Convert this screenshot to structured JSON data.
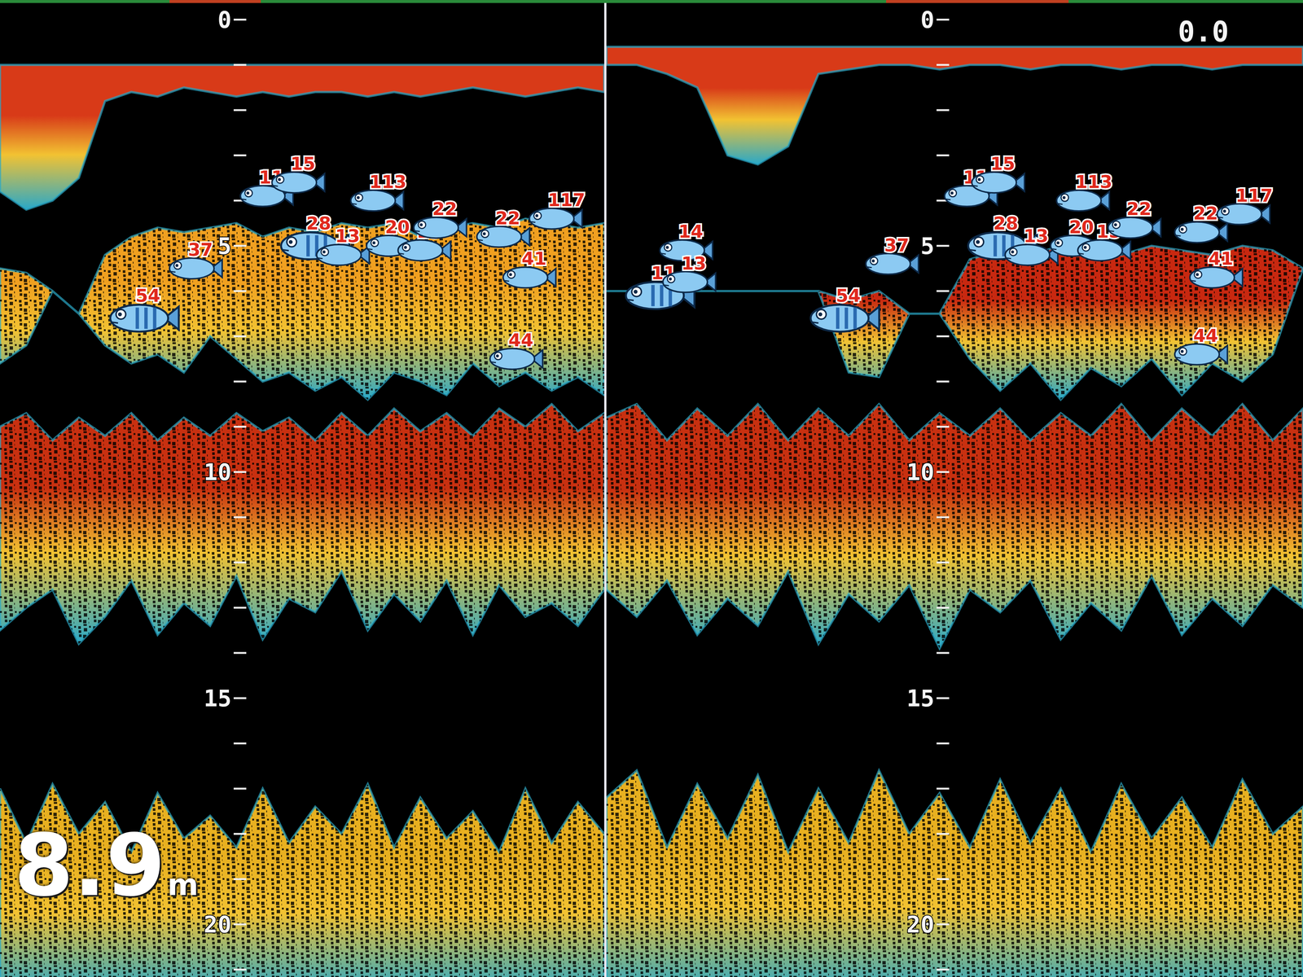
{
  "panels": [
    {
      "name": "left",
      "scale": [
        {
          "label": "0",
          "depth": 0
        },
        {
          "label": "5",
          "depth": 5
        },
        {
          "label": "10",
          "depth": 10
        },
        {
          "label": "15",
          "depth": 15
        },
        {
          "label": "20",
          "depth": 20
        }
      ],
      "layers": [
        {
          "kind": "surface",
          "color": "#d83a18",
          "top": [
            1.0,
            1.0,
            1.0,
            1.0,
            1.0,
            1.0,
            1.0,
            1.0,
            1.0,
            1.0,
            1.0,
            1.0,
            1.0,
            1.0,
            1.0,
            1.0,
            1.0,
            1.0,
            1.0,
            1.0,
            1.0,
            1.0,
            1.0,
            1.0
          ],
          "bottom": [
            3.8,
            4.2,
            4.0,
            3.5,
            1.8,
            1.6,
            1.7,
            1.5,
            1.6,
            1.7,
            1.6,
            1.7,
            1.6,
            1.6,
            1.7,
            1.6,
            1.7,
            1.6,
            1.5,
            1.6,
            1.7,
            1.6,
            1.5,
            1.6
          ]
        },
        {
          "kind": "school",
          "color": "#f0a020",
          "top": [
            5.5,
            5.6,
            6.0,
            6.5,
            5.2,
            4.8,
            4.6,
            4.7,
            4.6,
            4.5,
            4.8,
            4.6,
            4.7,
            4.5,
            4.6,
            4.5,
            4.8,
            4.6,
            4.5,
            4.6,
            4.4,
            4.5,
            4.6,
            4.5
          ],
          "bottom": [
            7.6,
            7.2,
            6.0,
            6.5,
            7.2,
            7.6,
            7.4,
            7.8,
            7.0,
            7.5,
            8.0,
            7.8,
            8.2,
            7.9,
            8.4,
            7.8,
            8.0,
            8.3,
            7.6,
            8.1,
            7.8,
            8.2,
            7.9,
            8.3
          ]
        },
        {
          "kind": "band",
          "color": "#c83010",
          "top": [
            9.0,
            8.7,
            9.3,
            8.8,
            9.2,
            8.7,
            9.3,
            8.8,
            9.2,
            8.7,
            9.1,
            8.8,
            9.3,
            8.7,
            9.2,
            8.6,
            9.1,
            8.7,
            9.2,
            8.6,
            9.0,
            8.5,
            9.1,
            8.7
          ],
          "bottom": [
            13.5,
            13.0,
            12.6,
            13.8,
            13.2,
            12.4,
            13.6,
            12.9,
            13.4,
            12.3,
            13.7,
            12.8,
            13.1,
            12.2,
            13.5,
            12.7,
            13.3,
            12.4,
            13.6,
            12.5,
            13.2,
            12.9,
            13.4,
            12.6
          ]
        },
        {
          "kind": "bottom",
          "color": "#e8b020",
          "top": [
            17.0,
            18.2,
            16.9,
            18.0,
            17.3,
            18.4,
            17.1,
            18.1,
            17.6,
            18.3,
            17.0,
            18.2,
            17.4,
            18.0,
            16.9,
            18.3,
            17.2,
            18.1,
            17.5,
            18.4,
            17.0,
            18.2,
            17.3,
            18.0
          ],
          "bottom": [
            21.5,
            21.5,
            21.5,
            21.5,
            21.5,
            21.5,
            21.5,
            21.5,
            21.5,
            21.5,
            21.5,
            21.5,
            21.5,
            21.5,
            21.5,
            21.5,
            21.5,
            21.5,
            21.5,
            21.5,
            21.5,
            21.5,
            21.5,
            21.5
          ]
        }
      ],
      "fish": [
        {
          "label": "11",
          "ping": 10.0,
          "depth": 3.9,
          "large": false
        },
        {
          "label": "15",
          "ping": 11.2,
          "depth": 3.6,
          "large": false
        },
        {
          "label": "113",
          "ping": 14.2,
          "depth": 4.0,
          "large": false
        },
        {
          "label": "28",
          "ping": 11.8,
          "depth": 5.0,
          "large": true
        },
        {
          "label": "13",
          "ping": 12.9,
          "depth": 5.2,
          "large": false
        },
        {
          "label": "20",
          "ping": 14.8,
          "depth": 5.0,
          "large": false
        },
        {
          "label": "15",
          "ping": 16.0,
          "depth": 5.1,
          "large": false
        },
        {
          "label": "22",
          "ping": 16.6,
          "depth": 4.6,
          "large": false
        },
        {
          "label": "22",
          "ping": 19.0,
          "depth": 4.8,
          "large": false
        },
        {
          "label": "117",
          "ping": 21.0,
          "depth": 4.4,
          "large": false
        },
        {
          "label": "37",
          "ping": 7.3,
          "depth": 5.5,
          "large": false
        },
        {
          "label": "41",
          "ping": 20.0,
          "depth": 5.7,
          "large": false
        },
        {
          "label": "54",
          "ping": 5.3,
          "depth": 6.6,
          "large": true
        },
        {
          "label": "44",
          "ping": 19.5,
          "depth": 7.5,
          "large": false
        }
      ]
    },
    {
      "name": "right",
      "scale": [
        {
          "label": "0",
          "depth": 0
        },
        {
          "label": "5",
          "depth": 5
        },
        {
          "label": "10",
          "depth": 10
        },
        {
          "label": "15",
          "depth": 15
        },
        {
          "label": "20",
          "depth": 20
        }
      ],
      "layers": [
        {
          "kind": "surface",
          "color": "#d83a18",
          "top": [
            0.6,
            0.6,
            0.6,
            0.6,
            0.6,
            0.6,
            0.6,
            0.6,
            0.6,
            0.6,
            0.6,
            0.6,
            0.6,
            0.6,
            0.6,
            0.6,
            0.6,
            0.6,
            0.6,
            0.6,
            0.6,
            0.6,
            0.6,
            0.6
          ],
          "bottom": [
            1.0,
            1.0,
            1.2,
            1.5,
            3.0,
            3.2,
            2.8,
            1.2,
            1.1,
            1.0,
            1.0,
            1.1,
            1.0,
            1.0,
            1.1,
            1.0,
            1.0,
            1.1,
            1.0,
            1.0,
            1.1,
            1.0,
            1.0,
            1.0
          ]
        },
        {
          "kind": "school",
          "color": "#c82810",
          "top": [
            6.0,
            6.0,
            6.0,
            6.0,
            6.0,
            6.0,
            6.0,
            6.0,
            6.2,
            6.0,
            6.5,
            6.5,
            5.3,
            5.1,
            5.2,
            5.0,
            5.1,
            5.2,
            5.0,
            5.1,
            5.2,
            5.0,
            5.1,
            5.5
          ],
          "bottom": [
            6.0,
            6.0,
            6.0,
            6.0,
            6.0,
            6.0,
            6.0,
            6.0,
            7.8,
            7.9,
            6.5,
            6.5,
            7.5,
            8.2,
            7.6,
            8.4,
            7.7,
            8.1,
            7.5,
            8.3,
            7.6,
            8.0,
            7.4,
            5.5
          ]
        },
        {
          "kind": "band",
          "color": "#c83010",
          "top": [
            8.8,
            8.5,
            9.3,
            8.6,
            9.2,
            8.5,
            9.3,
            8.6,
            9.2,
            8.5,
            9.3,
            8.7,
            9.2,
            8.6,
            9.3,
            8.7,
            9.2,
            8.5,
            9.3,
            8.6,
            9.2,
            8.5,
            9.3,
            8.6
          ],
          "bottom": [
            12.6,
            13.2,
            12.4,
            13.6,
            12.8,
            13.4,
            12.2,
            13.8,
            12.7,
            13.3,
            12.5,
            13.9,
            12.6,
            13.1,
            12.4,
            13.7,
            12.9,
            13.5,
            12.3,
            13.6,
            12.8,
            13.4,
            12.5,
            13.0
          ]
        },
        {
          "kind": "bottom",
          "color": "#e8b020",
          "top": [
            17.2,
            16.6,
            18.3,
            16.9,
            18.1,
            16.7,
            18.4,
            17.0,
            18.2,
            16.6,
            18.0,
            17.1,
            18.3,
            16.8,
            18.2,
            17.0,
            18.4,
            16.9,
            18.1,
            17.2,
            18.3,
            16.8,
            18.0,
            17.4
          ],
          "bottom": [
            21.5,
            21.5,
            21.5,
            21.5,
            21.5,
            21.5,
            21.5,
            21.5,
            21.5,
            21.5,
            21.5,
            21.5,
            21.5,
            21.5,
            21.5,
            21.5,
            21.5,
            21.5,
            21.5,
            21.5,
            21.5,
            21.5,
            21.5,
            21.5
          ]
        }
      ],
      "fish": [
        {
          "label": "14",
          "ping": 2.5,
          "depth": 5.1,
          "large": false
        },
        {
          "label": "11",
          "ping": 1.6,
          "depth": 6.1,
          "large": true
        },
        {
          "label": "13",
          "ping": 2.6,
          "depth": 5.8,
          "large": false
        },
        {
          "label": "11",
          "ping": 11.9,
          "depth": 3.9,
          "large": false
        },
        {
          "label": "15",
          "ping": 12.8,
          "depth": 3.6,
          "large": false
        },
        {
          "label": "113",
          "ping": 15.6,
          "depth": 4.0,
          "large": false
        },
        {
          "label": "28",
          "ping": 12.9,
          "depth": 5.0,
          "large": true
        },
        {
          "label": "13",
          "ping": 13.9,
          "depth": 5.2,
          "large": false
        },
        {
          "label": "20",
          "ping": 15.4,
          "depth": 5.0,
          "large": false
        },
        {
          "label": "15",
          "ping": 16.3,
          "depth": 5.1,
          "large": false
        },
        {
          "label": "22",
          "ping": 17.3,
          "depth": 4.6,
          "large": false
        },
        {
          "label": "22",
          "ping": 19.5,
          "depth": 4.7,
          "large": false
        },
        {
          "label": "117",
          "ping": 20.9,
          "depth": 4.3,
          "large": false
        },
        {
          "label": "37",
          "ping": 9.3,
          "depth": 5.4,
          "large": false
        },
        {
          "label": "41",
          "ping": 20.0,
          "depth": 5.7,
          "large": false
        },
        {
          "label": "54",
          "ping": 7.7,
          "depth": 6.6,
          "large": true
        },
        {
          "label": "44",
          "ping": 19.5,
          "depth": 7.4,
          "large": false
        }
      ]
    }
  ],
  "depth_readout": {
    "value": "8.9",
    "unit": "m"
  },
  "range_readout": "0.0"
}
